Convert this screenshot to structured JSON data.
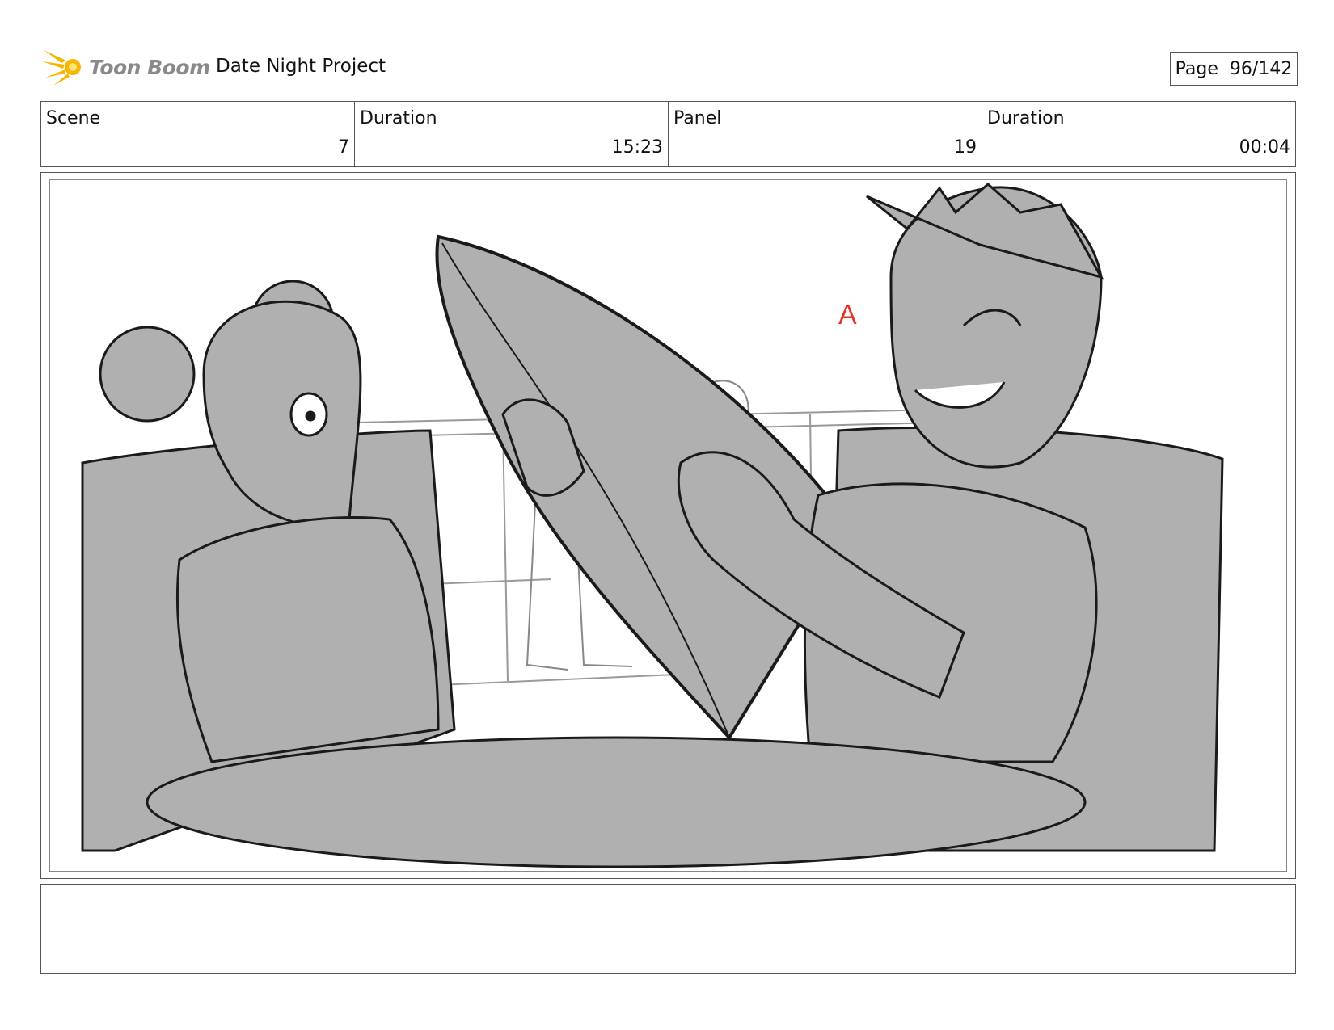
{
  "header": {
    "logo_text": "Toon Boom",
    "project_title": "Date Night Project",
    "page_label": "Page",
    "page_value": "96/142"
  },
  "info": {
    "scene_label": "Scene",
    "scene_value": "7",
    "scene_duration_label": "Duration",
    "scene_duration_value": "15:23",
    "panel_label": "Panel",
    "panel_value": "19",
    "panel_duration_label": "Duration",
    "panel_duration_value": "00:04"
  },
  "panel": {
    "annotation": "A",
    "annotation_color": "#e8321e"
  },
  "colors": {
    "logo_accent": "#f7b500",
    "sketch_fill": "#b0b0b0",
    "sketch_line": "#1a1a1a"
  }
}
